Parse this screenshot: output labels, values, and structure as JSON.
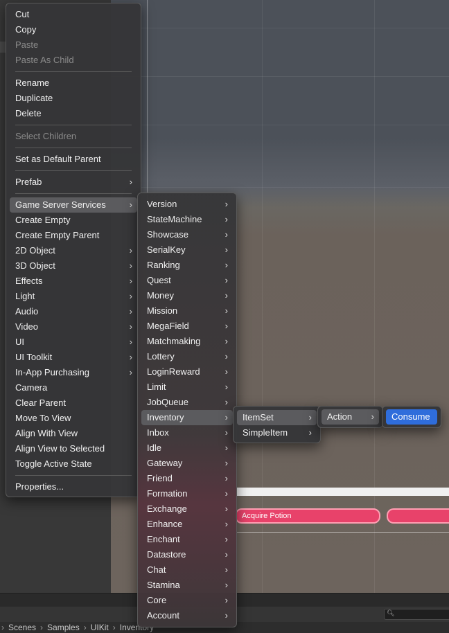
{
  "breadcrumb": [
    "Scenes",
    "Samples",
    "UIKit",
    "Inventory"
  ],
  "scene": {
    "potion_button_label": "Acquire Potion"
  },
  "icons": {
    "submenu": "chevron-right-icon",
    "search": "search-icon"
  },
  "colors": {
    "menu_bg": "#363638",
    "highlight": "#5b5b5e",
    "selected": "#2f6ddb",
    "potion": "#e8426a"
  },
  "main_menu": {
    "items": [
      {
        "label": "Cut",
        "type": "item"
      },
      {
        "label": "Copy",
        "type": "item"
      },
      {
        "label": "Paste",
        "type": "disabled"
      },
      {
        "label": "Paste As Child",
        "type": "disabled"
      },
      {
        "type": "separator"
      },
      {
        "label": "Rename",
        "type": "item"
      },
      {
        "label": "Duplicate",
        "type": "item"
      },
      {
        "label": "Delete",
        "type": "item"
      },
      {
        "type": "separator"
      },
      {
        "label": "Select Children",
        "type": "disabled"
      },
      {
        "type": "separator"
      },
      {
        "label": "Set as Default Parent",
        "type": "item"
      },
      {
        "type": "separator"
      },
      {
        "label": "Prefab",
        "type": "submenu"
      },
      {
        "type": "separator"
      },
      {
        "label": "Game Server Services",
        "type": "submenu",
        "state": "highlighted"
      },
      {
        "label": "Create Empty",
        "type": "item"
      },
      {
        "label": "Create Empty Parent",
        "type": "item"
      },
      {
        "label": "2D Object",
        "type": "submenu"
      },
      {
        "label": "3D Object",
        "type": "submenu"
      },
      {
        "label": "Effects",
        "type": "submenu"
      },
      {
        "label": "Light",
        "type": "submenu"
      },
      {
        "label": "Audio",
        "type": "submenu"
      },
      {
        "label": "Video",
        "type": "submenu"
      },
      {
        "label": "UI",
        "type": "submenu"
      },
      {
        "label": "UI Toolkit",
        "type": "submenu"
      },
      {
        "label": "In-App Purchasing",
        "type": "submenu"
      },
      {
        "label": "Camera",
        "type": "item"
      },
      {
        "label": "Clear Parent",
        "type": "item"
      },
      {
        "label": "Move To View",
        "type": "item"
      },
      {
        "label": "Align With View",
        "type": "item"
      },
      {
        "label": "Align View to Selected",
        "type": "item"
      },
      {
        "label": "Toggle Active State",
        "type": "item"
      },
      {
        "type": "separator"
      },
      {
        "label": "Properties...",
        "type": "item"
      }
    ]
  },
  "gss_menu": {
    "items": [
      {
        "label": "Version",
        "type": "submenu"
      },
      {
        "label": "StateMachine",
        "type": "submenu"
      },
      {
        "label": "Showcase",
        "type": "submenu"
      },
      {
        "label": "SerialKey",
        "type": "submenu"
      },
      {
        "label": "Ranking",
        "type": "submenu"
      },
      {
        "label": "Quest",
        "type": "submenu"
      },
      {
        "label": "Money",
        "type": "submenu"
      },
      {
        "label": "Mission",
        "type": "submenu"
      },
      {
        "label": "MegaField",
        "type": "submenu"
      },
      {
        "label": "Matchmaking",
        "type": "submenu"
      },
      {
        "label": "Lottery",
        "type": "submenu"
      },
      {
        "label": "LoginReward",
        "type": "submenu"
      },
      {
        "label": "Limit",
        "type": "submenu"
      },
      {
        "label": "JobQueue",
        "type": "submenu"
      },
      {
        "label": "Inventory",
        "type": "submenu",
        "state": "highlighted"
      },
      {
        "label": "Inbox",
        "type": "submenu"
      },
      {
        "label": "Idle",
        "type": "submenu"
      },
      {
        "label": "Gateway",
        "type": "submenu"
      },
      {
        "label": "Friend",
        "type": "submenu"
      },
      {
        "label": "Formation",
        "type": "submenu"
      },
      {
        "label": "Exchange",
        "type": "submenu"
      },
      {
        "label": "Enhance",
        "type": "submenu"
      },
      {
        "label": "Enchant",
        "type": "submenu"
      },
      {
        "label": "Datastore",
        "type": "submenu"
      },
      {
        "label": "Chat",
        "type": "submenu"
      },
      {
        "label": "Stamina",
        "type": "submenu"
      },
      {
        "label": "Core",
        "type": "submenu"
      },
      {
        "label": "Account",
        "type": "submenu"
      }
    ]
  },
  "inventory_menu": {
    "items": [
      {
        "label": "ItemSet",
        "type": "submenu",
        "state": "highlighted"
      },
      {
        "label": "SimpleItem",
        "type": "submenu"
      }
    ]
  },
  "itemset_menu": {
    "items": [
      {
        "label": "Action",
        "type": "submenu",
        "state": "highlighted"
      }
    ]
  },
  "action_menu": {
    "items": [
      {
        "label": "Consume",
        "type": "item",
        "state": "selected"
      }
    ]
  }
}
